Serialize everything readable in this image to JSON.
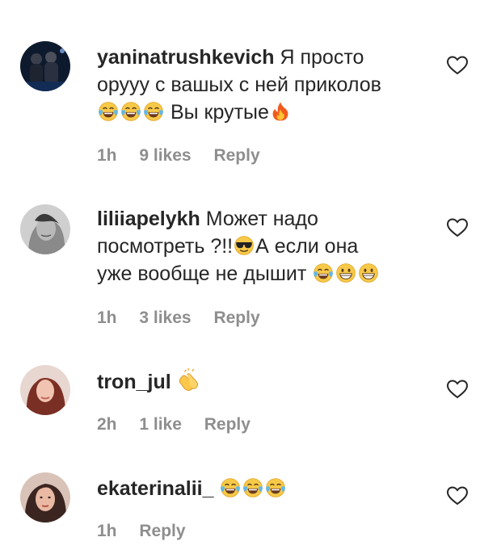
{
  "comments": [
    {
      "username": "yaninatrushkevich",
      "line1": "Я просто",
      "line2": "орууу с вашых с ней приколов",
      "line3": "Вы крутые",
      "time": "1h",
      "likes": "9 likes",
      "reply": "Reply"
    },
    {
      "username": "liliiapelykh",
      "line1": "Может надо",
      "line2": "посмотреть ?!!",
      "line2b": "А если она",
      "line3": "уже вообще не дышит",
      "time": "1h",
      "likes": "3 likes",
      "reply": "Reply"
    },
    {
      "username": "tron_jul",
      "time": "2h",
      "likes": "1 like",
      "reply": "Reply"
    },
    {
      "username": "ekaterinalii_",
      "time": "1h",
      "reply": "Reply"
    }
  ],
  "icons": {
    "like": "heart-outline-icon",
    "laugh": "face-with-tears-of-joy-emoji",
    "fire": "fire-emoji",
    "sunglasses": "smiling-face-with-sunglasses-emoji",
    "grin": "grinning-face-emoji",
    "clap": "clapping-hands-emoji"
  },
  "colors": {
    "text": "#262626",
    "meta": "#8e8e8e",
    "background": "#ffffff"
  }
}
